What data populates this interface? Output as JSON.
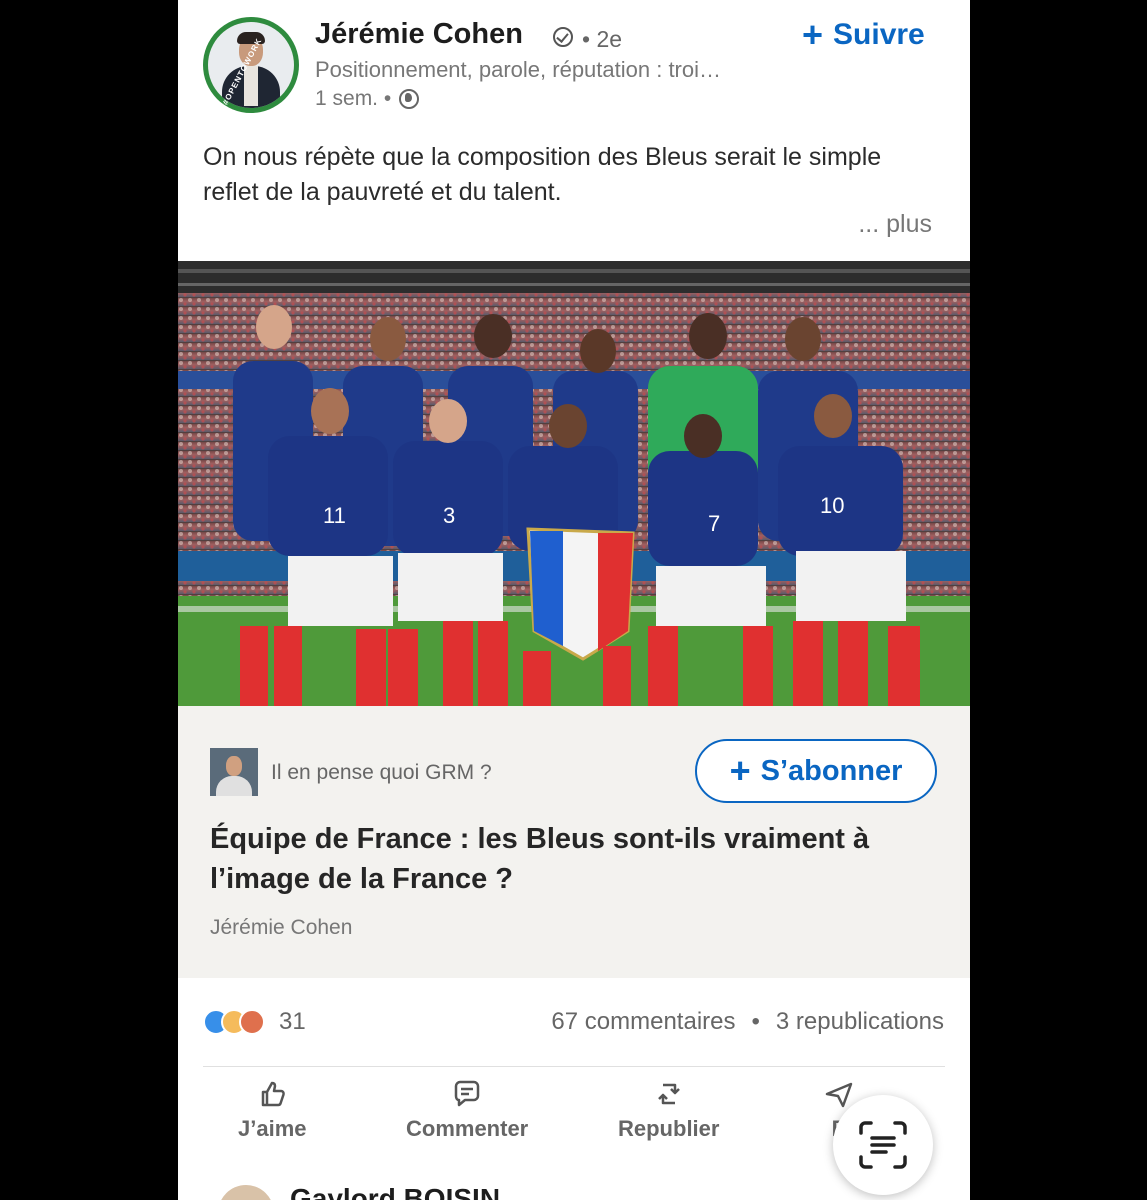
{
  "post": {
    "author_name": "Jérémie Cohen",
    "degree": "• 2e",
    "follow_label": "Suivre",
    "headline": "Positionnement, parole, réputation : troi…",
    "timestamp": "1 sem. •",
    "text": "On nous répète que la composition des Bleus serait le simple reflet de la pauvreté et du talent.",
    "more_label": "... plus",
    "image_icon": "team-photo",
    "avatar_badge": "#OPENTOWORK"
  },
  "article": {
    "newsletter_name": "Il en pense quoi GRM ?",
    "subscribe_label": "S’abonner",
    "title": "Équipe de France : les Bleus sont-ils vraiment à l’image de la France ?",
    "author": "Jérémie Cohen"
  },
  "social": {
    "reaction_icons": [
      "like-icon",
      "insightful-icon",
      "love-icon"
    ],
    "reaction_count": "31",
    "comments": "67 commentaires",
    "separator": "•",
    "reposts": "3 republications"
  },
  "actions": {
    "like": "J’aime",
    "comment": "Commenter",
    "repost": "Republier",
    "send": "E"
  },
  "next_post": {
    "author_name": "Gaylord BOISIN"
  },
  "colors": {
    "brand_blue": "#0a66c2",
    "open_to_work_green": "#2e8b3e",
    "france_blue": "#1f3a8a",
    "france_red": "#e03030"
  }
}
